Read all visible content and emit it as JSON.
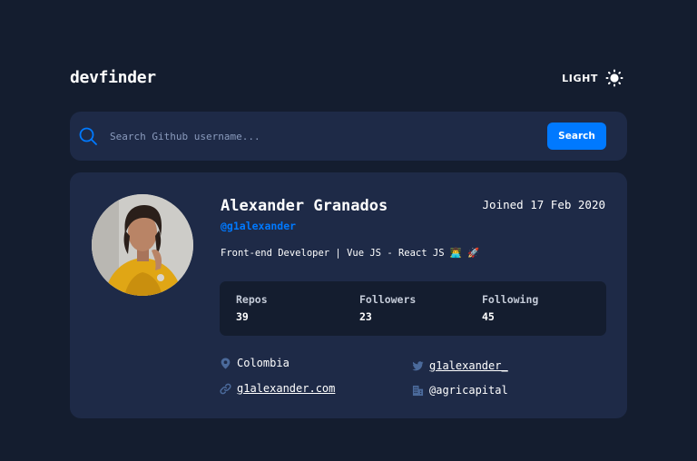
{
  "header": {
    "logo": "devfinder",
    "theme_label": "LIGHT"
  },
  "search": {
    "placeholder": "Search Github username...",
    "button_label": "Search"
  },
  "profile": {
    "name": "Alexander Granados",
    "login": "@g1alexander",
    "joined": "Joined 17 Feb 2020",
    "bio": "Front-end Developer | Vue JS - React JS 👨‍💻 🚀",
    "stats": [
      {
        "label": "Repos",
        "value": "39"
      },
      {
        "label": "Followers",
        "value": "23"
      },
      {
        "label": "Following",
        "value": "45"
      }
    ],
    "links": {
      "location": "Colombia",
      "twitter": "g1alexander_",
      "website": "g1alexander.com",
      "company": "@agricapital"
    }
  },
  "colors": {
    "background": "#141d2f",
    "card": "#1e2a47",
    "accent": "#0079ff",
    "icon_muted": "#4b6a9b"
  },
  "icons": {
    "theme": "sun-icon",
    "search": "search-icon",
    "location": "location-pin-icon",
    "twitter": "twitter-icon",
    "website": "link-icon",
    "company": "company-building-icon"
  }
}
